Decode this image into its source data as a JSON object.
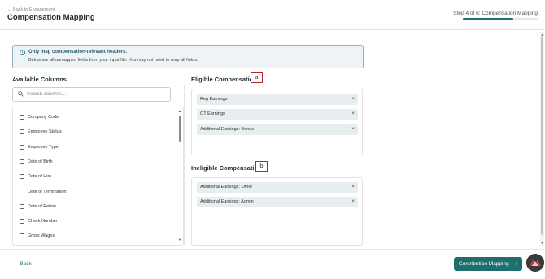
{
  "header": {
    "back_link": "← Back to Engagement",
    "title": "Compensation Mapping",
    "step_text": "Step 4 of 6: Compensation Mapping",
    "step_progress": 0.67
  },
  "info": {
    "title": "Only map compensation-relevant headers.",
    "text": "Below are all unmapped fields from your input file. You may not need to map all fields."
  },
  "available": {
    "title": "Available Columns",
    "search_placeholder": "Search columns...",
    "items": [
      "Company Code",
      "Employee Status",
      "Employee Type",
      "Date of Birth",
      "Date of Hire",
      "Date of Termination",
      "Date of Rehire",
      "Check Number",
      "Gross Wages"
    ]
  },
  "eligible": {
    "title": "Eligible Compensation",
    "callout": "a",
    "items": [
      "Reg Earnings",
      "OT Earnings",
      "Additional Earnings: Bonus"
    ]
  },
  "ineligible": {
    "title": "Ineligible Compensation",
    "callout": "b",
    "items": [
      "Additional Earnings: Other",
      "Additional Earnings: Admin"
    ]
  },
  "footer": {
    "back_label": "← Back",
    "next_label": "Contribution Mapping"
  },
  "remove_glyph": "×",
  "colors": {
    "accent": "#1c6f6c",
    "chip_bg": "#e7eef0",
    "callout_border": "#c0202a",
    "info_border": "#8fb4bf"
  }
}
